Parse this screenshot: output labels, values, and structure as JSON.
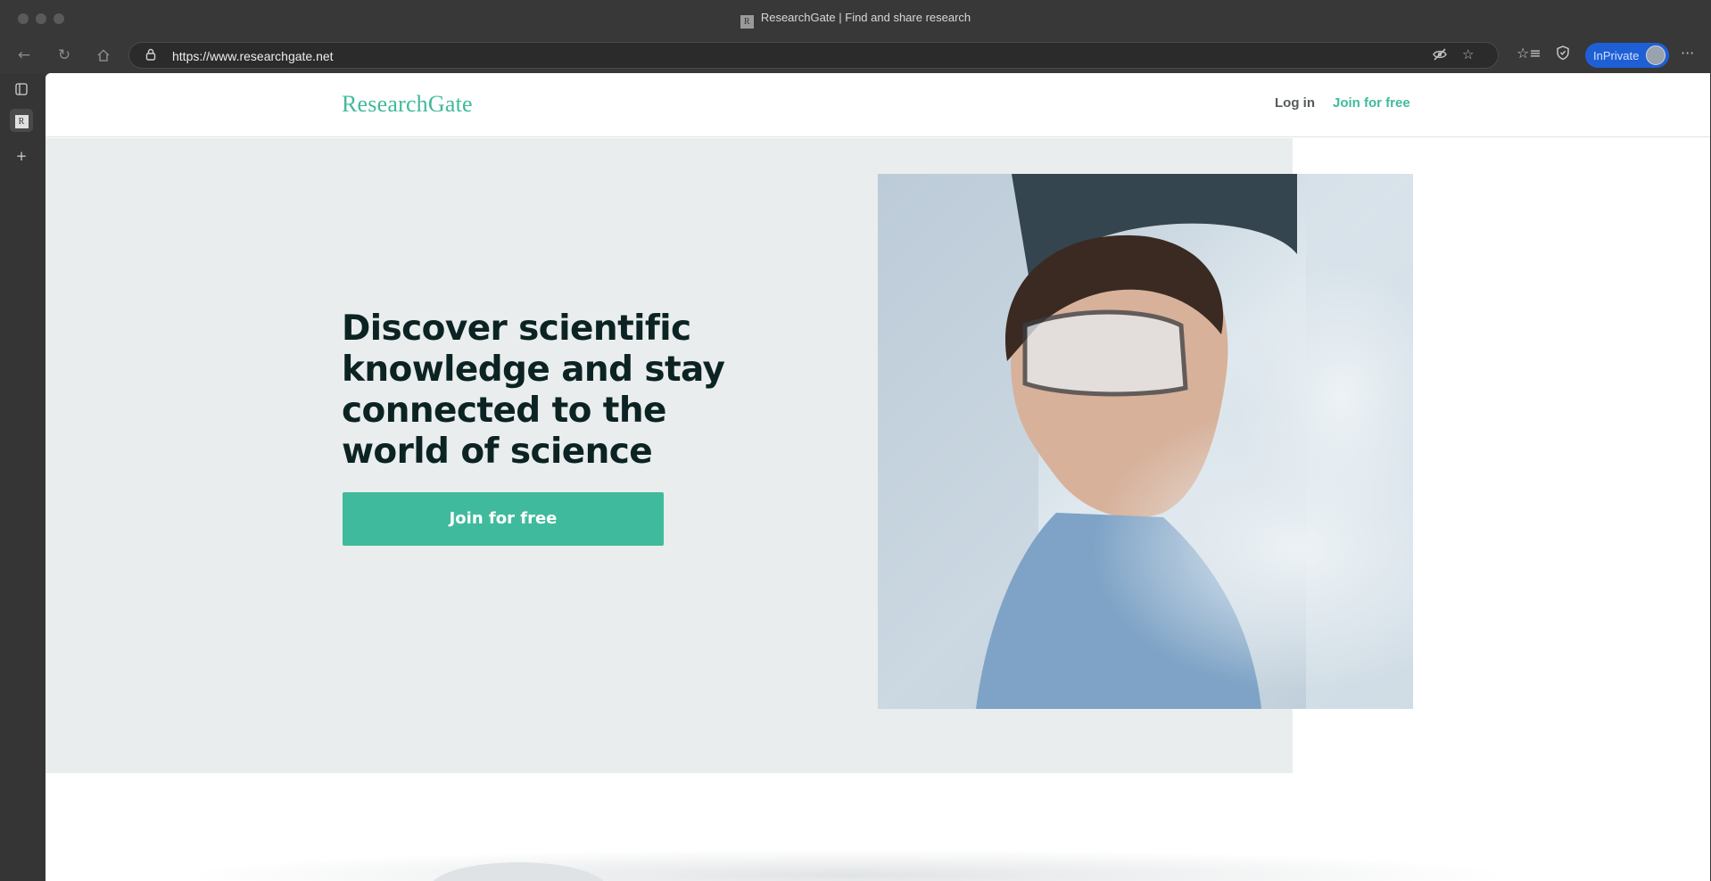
{
  "browser": {
    "tab_title": "ResearchGate | Find and share research",
    "favicon_text": "R",
    "url": "https://www.researchgate.net",
    "inprivate_label": "InPrivate"
  },
  "page": {
    "logo": "ResearchGate",
    "nav": {
      "login": "Log in",
      "join": "Join for free"
    },
    "hero": {
      "title": "Discover scientific knowledge and stay connected to the world of science",
      "cta": "Join for free"
    }
  },
  "colors": {
    "brand": "#40ba9c",
    "hero_bg": "#e9eded",
    "title_text": "#0c2323",
    "inprivate": "#1f5fd6"
  },
  "icons": {
    "back": "arrow-left-icon",
    "refresh": "refresh-icon",
    "home": "home-icon",
    "lock": "lock-icon",
    "tracking": "eye-slash-icon",
    "favorite": "star-icon",
    "favorites": "favorites-icon",
    "security": "shield-icon",
    "more": "more-icon",
    "tabs": "tab-actions-icon",
    "new_tab": "plus-icon"
  }
}
